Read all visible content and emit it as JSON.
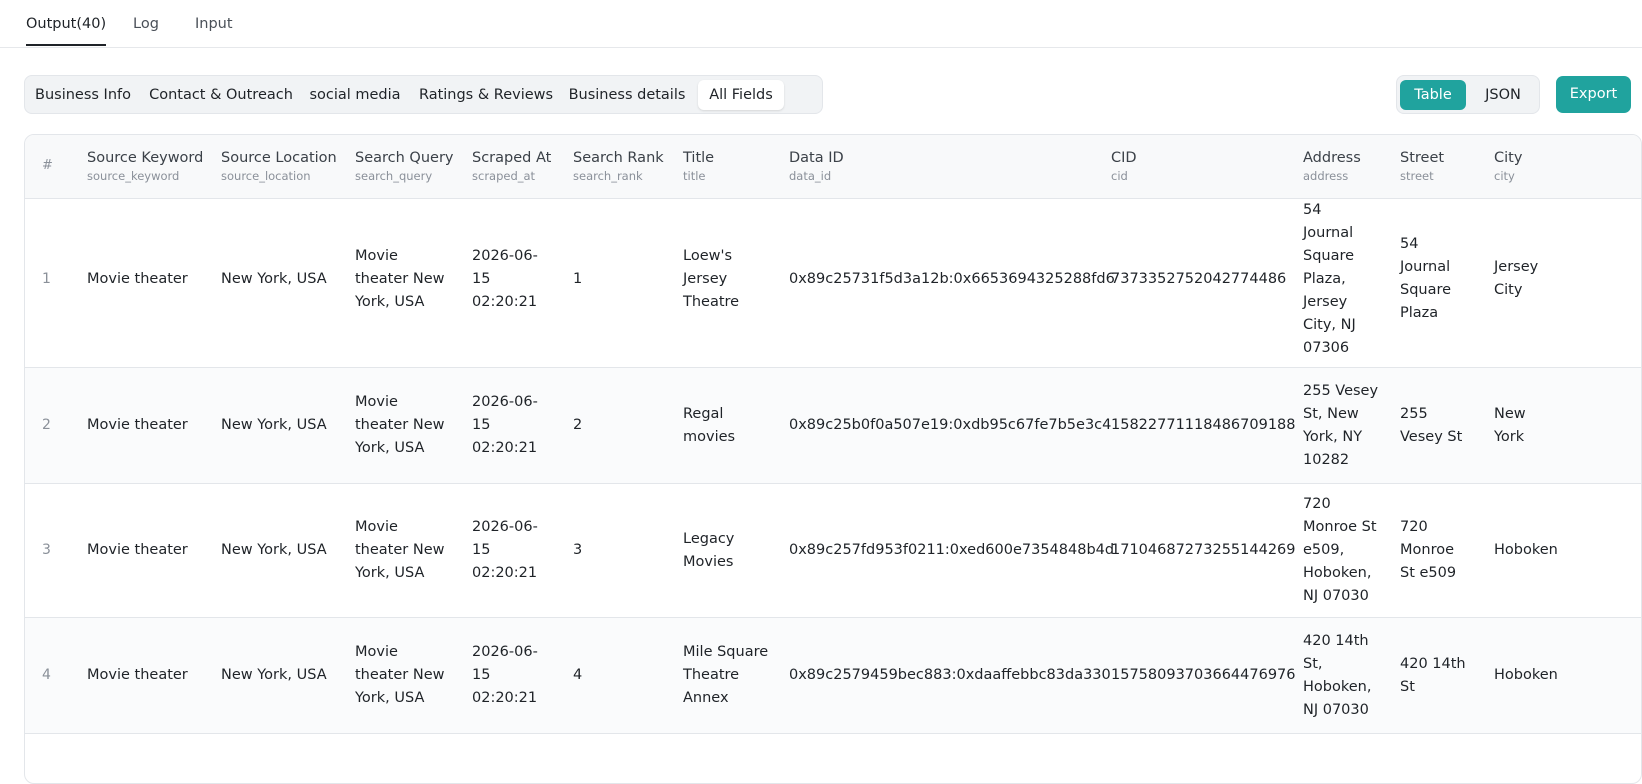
{
  "top_tabs": [
    {
      "label": "Output(40)"
    },
    {
      "label": "Log"
    },
    {
      "label": "Input"
    }
  ],
  "field_groups": [
    {
      "label": "Business Info"
    },
    {
      "label": "Contact & Outreach"
    },
    {
      "label": "social media"
    },
    {
      "label": "Ratings & Reviews"
    },
    {
      "label": "Business details"
    },
    {
      "label": "All Fields"
    }
  ],
  "active_field_group": "All Fields",
  "view_modes": [
    {
      "label": "Table"
    },
    {
      "label": "JSON"
    }
  ],
  "active_view_mode": "Table",
  "export_label": "Export",
  "accent_color": "#20a39e",
  "table": {
    "columns": [
      {
        "label": "#",
        "key": ""
      },
      {
        "label": "Source Keyword",
        "key": "source_keyword"
      },
      {
        "label": "Source Location",
        "key": "source_location"
      },
      {
        "label": "Search Query",
        "key": "search_query"
      },
      {
        "label": "Scraped At",
        "key": "scraped_at"
      },
      {
        "label": "Search Rank",
        "key": "search_rank"
      },
      {
        "label": "Title",
        "key": "title"
      },
      {
        "label": "Data ID",
        "key": "data_id"
      },
      {
        "label": "CID",
        "key": "cid"
      },
      {
        "label": "Address",
        "key": "address"
      },
      {
        "label": "Street",
        "key": "street"
      },
      {
        "label": "City",
        "key": "city"
      }
    ],
    "rows": [
      {
        "index": "1",
        "source_keyword": "Movie theater",
        "source_location": "New York, USA",
        "search_query": [
          "Movie",
          "theater New",
          "York, USA"
        ],
        "scraped_at": [
          "2026-06-",
          "15",
          "02:20:21"
        ],
        "search_rank": "1",
        "title": [
          "Loew's",
          "Jersey",
          "Theatre"
        ],
        "data_id": "0x89c25731f5d3a12b:0x6653694325288fd6",
        "cid": "7373352752042774486",
        "address": [
          "54",
          "Journal",
          "Square",
          "Plaza,",
          "Jersey",
          "City, NJ",
          "07306"
        ],
        "street": [
          "54",
          "Journal",
          "Square",
          "Plaza"
        ],
        "city": [
          "Jersey",
          "City"
        ]
      },
      {
        "index": "2",
        "source_keyword": "Movie theater",
        "source_location": "New York, USA",
        "search_query": [
          "Movie",
          "theater New",
          "York, USA"
        ],
        "scraped_at": [
          "2026-06-",
          "15",
          "02:20:21"
        ],
        "search_rank": "2",
        "title": [
          "Regal",
          "movies"
        ],
        "data_id": "0x89c25b0f0a507e19:0xdb95c67fe7b5e3c4",
        "cid": "15822771118486709188",
        "address": [
          "255 Vesey",
          "St, New",
          "York, NY",
          "10282"
        ],
        "street": [
          "255",
          "Vesey St"
        ],
        "city": [
          "New",
          "York"
        ]
      },
      {
        "index": "3",
        "source_keyword": "Movie theater",
        "source_location": "New York, USA",
        "search_query": [
          "Movie",
          "theater New",
          "York, USA"
        ],
        "scraped_at": [
          "2026-06-",
          "15",
          "02:20:21"
        ],
        "search_rank": "3",
        "title": [
          "Legacy",
          "Movies"
        ],
        "data_id": "0x89c257fd953f0211:0xed600e7354848b4d",
        "cid": "17104687273255144269",
        "address": [
          "720",
          "Monroe St",
          "e509,",
          "Hoboken,",
          "NJ 07030"
        ],
        "street": [
          "720",
          "Monroe",
          "St e509"
        ],
        "city": [
          "Hoboken"
        ]
      },
      {
        "index": "4",
        "source_keyword": "Movie theater",
        "source_location": "New York, USA",
        "search_query": [
          "Movie",
          "theater New",
          "York, USA"
        ],
        "scraped_at": [
          "2026-06-",
          "15",
          "02:20:21"
        ],
        "search_rank": "4",
        "title": [
          "Mile Square",
          "Theatre",
          "Annex"
        ],
        "data_id": "0x89c2579459bec883:0xdaaffebbc83da330",
        "cid": "15758093703664476976",
        "address": [
          "420 14th",
          "St,",
          "Hoboken,",
          "NJ 07030"
        ],
        "street": [
          "420 14th",
          "St"
        ],
        "city": [
          "Hoboken"
        ]
      }
    ]
  }
}
